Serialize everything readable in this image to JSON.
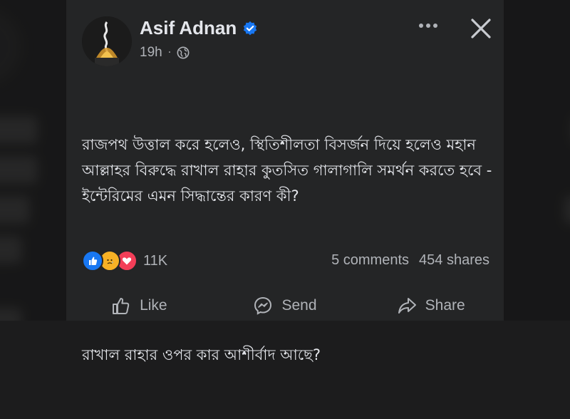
{
  "post": {
    "author": "Asif Adnan",
    "time": "19h",
    "dot": "·",
    "paragraphs": [
      "রাজপথ উত্তাল করে হলেও, স্থিতিশীলতা বিসর্জন দিয়ে হলেও মহান আল্লাহর বিরুদ্ধে রাখাল রাহার কুতসিত গালাগালি সমর্থন করতে হবে - ইন্টেরিমের এমন সিদ্ধান্তের কারণ কী?",
      "রাখাল রাহার ওপর কার আশীর্বাদ আছে?"
    ],
    "reaction_count": "11K",
    "comments": "5 comments",
    "shares": "454 shares",
    "reactions": [
      "like-icon",
      "sad-icon",
      "love-icon"
    ]
  },
  "actions": {
    "like": "Like",
    "send": "Send",
    "share": "Share"
  },
  "colors": {
    "card_bg": "#242526",
    "text": "#e4e6eb",
    "muted": "#b0b3b8",
    "verified": "#1877f2",
    "like": "#1877f2",
    "love": "#f33e58",
    "sad": "#f7b125"
  }
}
